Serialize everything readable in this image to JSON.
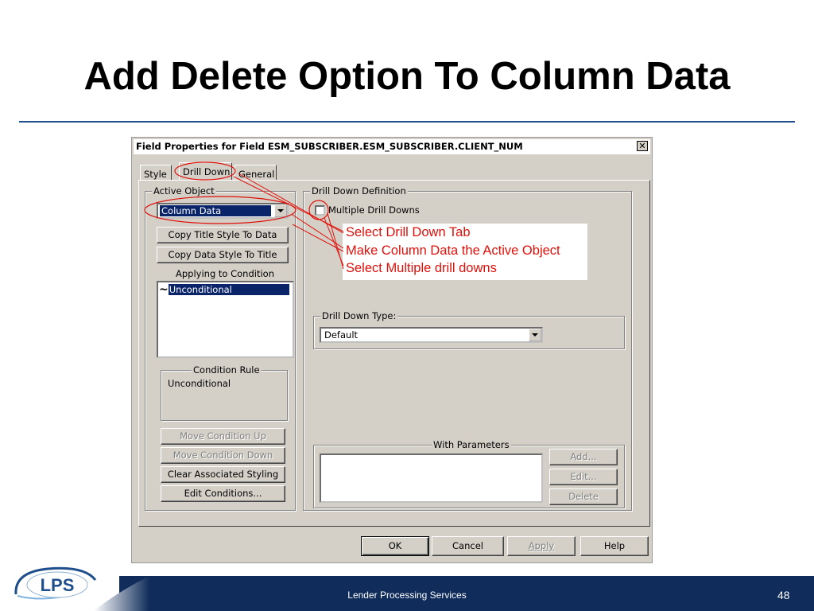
{
  "slide": {
    "title": "Add Delete Option To Column Data",
    "footer_text": "Lender Processing Services",
    "page_number": "48",
    "logo_text": "LPS"
  },
  "dialog": {
    "title": "Field Properties for Field ESM_SUBSCRIBER.ESM_SUBSCRIBER.CLIENT_NUM",
    "close_glyph": "✕",
    "tabs": [
      {
        "label": "Style"
      },
      {
        "label": "Drill Down"
      },
      {
        "label": "General"
      }
    ],
    "active_object": {
      "legend": "Active Object",
      "value": "Column Data"
    },
    "copy_title_style_label": "Copy Title Style To Data",
    "copy_data_style_label": "Copy Data Style To Title",
    "applying_to_condition": {
      "legend": "Applying to Condition",
      "items": [
        {
          "glyph": "~",
          "label": "Unconditional"
        }
      ]
    },
    "condition_rule": {
      "legend": "Condition Rule",
      "value": "Unconditional"
    },
    "move_up_label": "Move Condition Up",
    "move_down_label": "Move Condition Down",
    "clear_styling_label": "Clear Associated Styling",
    "edit_conditions_label": "Edit Conditions...",
    "drill_down_definition": {
      "legend": "Drill Down Definition",
      "multiple_label": "Multiple Drill Downs",
      "multiple_checked": false
    },
    "drill_down_type": {
      "legend": "Drill Down Type:",
      "value": "Default"
    },
    "with_parameters": {
      "legend": "With Parameters",
      "add_label": "Add...",
      "edit_label": "Edit...",
      "delete_label": "Delete"
    },
    "ok_label": "OK",
    "cancel_label": "Cancel",
    "apply_label": "Apply",
    "help_label": "Help"
  },
  "callout": {
    "lines": [
      "Select Drill Down Tab",
      "Make Column Data the Active Object",
      "Select Multiple drill downs"
    ],
    "color": "#e0100a"
  },
  "colors": {
    "accent": "#1f4e8c",
    "footer": "#0f2c5a",
    "dialog_bg": "#d4d0c8",
    "selection": "#0a246a"
  }
}
